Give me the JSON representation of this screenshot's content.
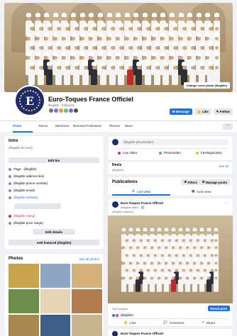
{
  "cover": {
    "edit_label": "Change cover photo (illegible)"
  },
  "page": {
    "name": "Euro-Toques France Officiel",
    "subtitle": "illegible · followers",
    "avatar_letter": "E"
  },
  "header_buttons": [
    "Message",
    "Like",
    "Follow"
  ],
  "tabs": [
    "Posts",
    "About",
    "Mentions",
    "Reviews",
    "Followers",
    "Photos",
    "More"
  ],
  "intro": {
    "title": "Intro",
    "bio": "(illegible bio text)",
    "edit_bio": "Edit bio",
    "details": [
      "Page · (illegible)",
      "(illegible address line)",
      "(illegible phone number)",
      "(illegible email)",
      "(illegible website)"
    ],
    "rating_label": "(illegible rating)",
    "price_label": "(illegible price range)",
    "edit_details": "Edit details",
    "add_featured": "Add featured (illegible)"
  },
  "photos": {
    "title": "Photos",
    "see_all": "See all photos",
    "colors": [
      "#c9a34d",
      "#8fa6c2",
      "#d4b07a",
      "#6c8e4a",
      "#e6d3b3",
      "#b37c4f",
      "#a7894f",
      "#3f5f8a",
      "#c9b48f"
    ]
  },
  "composer": {
    "placeholder": "(illegible placeholder)",
    "actions": [
      "Live video",
      "Photo/video",
      "Feeling/activity"
    ]
  },
  "reels": {
    "title": "Reels",
    "subtitle": "(illegible)",
    "link": "See all"
  },
  "posts_header": {
    "title": "Publications",
    "filters": "Filters",
    "manage": "Manage posts",
    "list_view": "List view",
    "grid_view": "Grid view"
  },
  "post": {
    "author": "Euro-Toques France Officiel",
    "meta": "(illegible date) · 🌐",
    "text": "(illegible caption)",
    "boost": "Boost post",
    "insights": "See insights",
    "reactions_count": "(illegible)",
    "actions": [
      "Like",
      "Comment",
      "Share"
    ]
  },
  "post2": {
    "author": "Euro-Toques France Officiel"
  }
}
